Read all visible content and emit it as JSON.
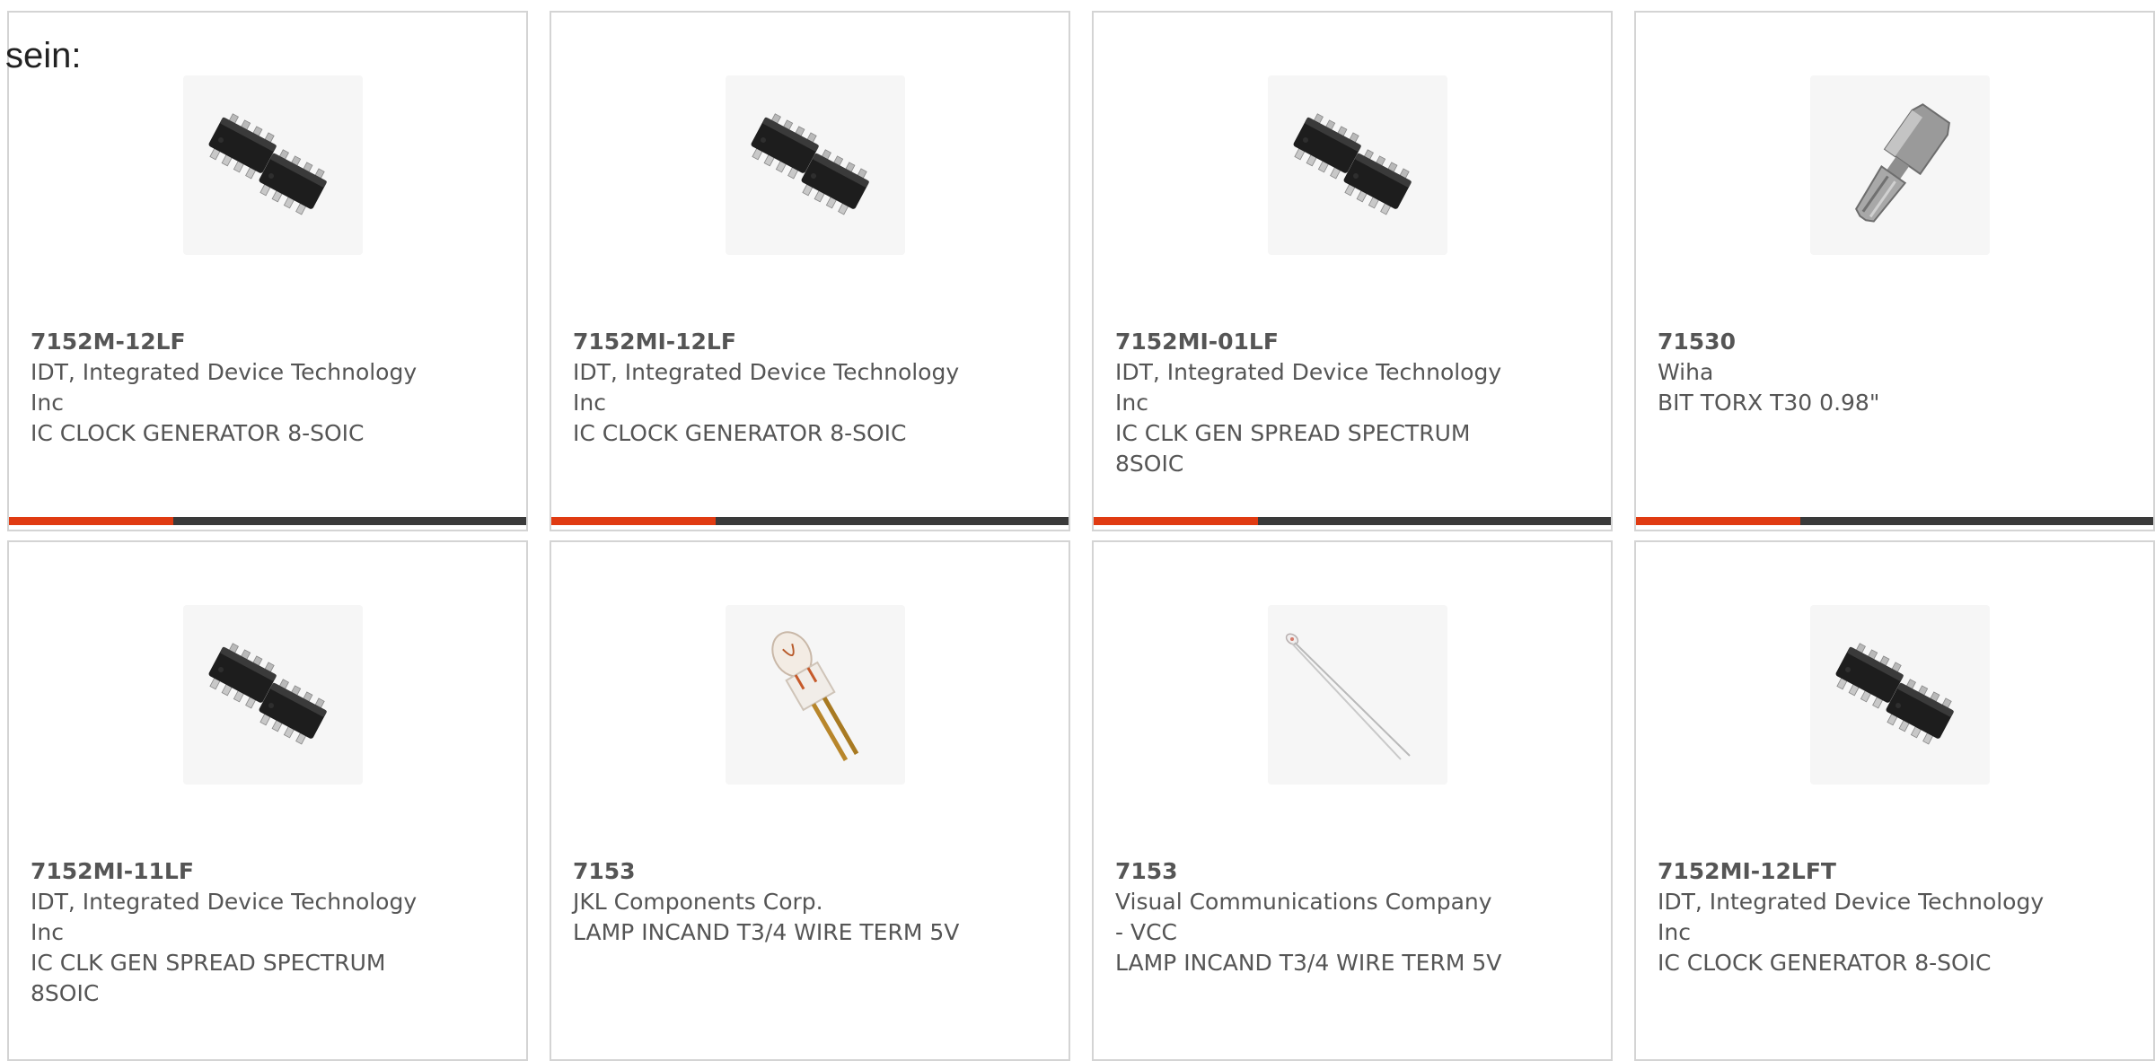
{
  "intro_text": "sein:",
  "accent_color": "#e03b12",
  "bar_color": "#3a3a3a",
  "products": [
    {
      "part": "7152M-12LF",
      "manufacturer": "IDT, Integrated Device Technology Inc",
      "description": "IC CLOCK GENERATOR 8-SOIC",
      "icon": "ic-chip-icon"
    },
    {
      "part": "7152MI-12LF",
      "manufacturer": "IDT, Integrated Device Technology Inc",
      "description": "IC CLOCK GENERATOR 8-SOIC",
      "icon": "ic-chip-icon"
    },
    {
      "part": "7152MI-01LF",
      "manufacturer": "IDT, Integrated Device Technology Inc",
      "description": "IC CLK GEN SPREAD SPECTRUM 8SOIC",
      "icon": "ic-chip-icon"
    },
    {
      "part": "71530",
      "manufacturer": "Wiha",
      "description": "BIT TORX T30 0.98\"",
      "icon": "torx-bit-icon"
    },
    {
      "part": "7152MI-11LF",
      "manufacturer": "IDT, Integrated Device Technology Inc",
      "description": "IC CLK GEN SPREAD SPECTRUM 8SOIC",
      "icon": "ic-chip-icon"
    },
    {
      "part": "7153",
      "manufacturer": "JKL Components Corp.",
      "description": "LAMP INCAND T3/4 WIRE TERM 5V",
      "icon": "lamp-icon"
    },
    {
      "part": "7153",
      "manufacturer": "Visual Communications Company - VCC",
      "description": "LAMP INCAND T3/4 WIRE TERM 5V",
      "icon": "wire-lamp-icon"
    },
    {
      "part": "7152MI-12LFT",
      "manufacturer": "IDT, Integrated Device Technology Inc",
      "description": "IC CLOCK GENERATOR 8-SOIC",
      "icon": "ic-chip-icon"
    }
  ]
}
